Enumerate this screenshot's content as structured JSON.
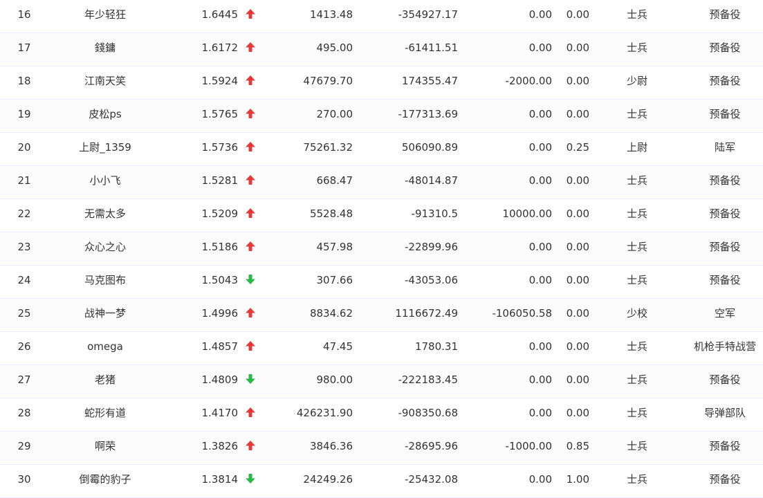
{
  "colors": {
    "up": "#e03b3b",
    "down": "#2fb44a",
    "text": "#333333",
    "row_border": "#ebeef5"
  },
  "rows": [
    {
      "rank": "16",
      "name": "年少轻狂",
      "ratio": "1.6445",
      "trend": "up",
      "a": "1413.48",
      "b": "-354927.17",
      "c": "0.00",
      "d": "0.00",
      "rank_title": "士兵",
      "unit": "预备役"
    },
    {
      "rank": "17",
      "name": "錢鏞",
      "ratio": "1.6172",
      "trend": "up",
      "a": "495.00",
      "b": "-61411.51",
      "c": "0.00",
      "d": "0.00",
      "rank_title": "士兵",
      "unit": "预备役"
    },
    {
      "rank": "18",
      "name": "江南天笑",
      "ratio": "1.5924",
      "trend": "up",
      "a": "47679.70",
      "b": "174355.47",
      "c": "-2000.00",
      "d": "0.00",
      "rank_title": "少尉",
      "unit": "预备役"
    },
    {
      "rank": "19",
      "name": "皮松ps",
      "ratio": "1.5765",
      "trend": "up",
      "a": "270.00",
      "b": "-177313.69",
      "c": "0.00",
      "d": "0.00",
      "rank_title": "士兵",
      "unit": "预备役"
    },
    {
      "rank": "20",
      "name": "上尉_1359",
      "ratio": "1.5736",
      "trend": "up",
      "a": "75261.32",
      "b": "506090.89",
      "c": "0.00",
      "d": "0.25",
      "rank_title": "上尉",
      "unit": "陆军"
    },
    {
      "rank": "21",
      "name": "小小飞",
      "ratio": "1.5281",
      "trend": "up",
      "a": "668.47",
      "b": "-48014.87",
      "c": "0.00",
      "d": "0.00",
      "rank_title": "士兵",
      "unit": "预备役"
    },
    {
      "rank": "22",
      "name": "无需太多",
      "ratio": "1.5209",
      "trend": "up",
      "a": "5528.48",
      "b": "-91310.5",
      "c": "10000.00",
      "d": "0.00",
      "rank_title": "士兵",
      "unit": "预备役"
    },
    {
      "rank": "23",
      "name": "众心之心",
      "ratio": "1.5186",
      "trend": "up",
      "a": "457.98",
      "b": "-22899.96",
      "c": "0.00",
      "d": "0.00",
      "rank_title": "士兵",
      "unit": "预备役"
    },
    {
      "rank": "24",
      "name": "马克图布",
      "ratio": "1.5043",
      "trend": "down",
      "a": "307.66",
      "b": "-43053.06",
      "c": "0.00",
      "d": "0.00",
      "rank_title": "士兵",
      "unit": "预备役"
    },
    {
      "rank": "25",
      "name": "战神一梦",
      "ratio": "1.4996",
      "trend": "up",
      "a": "8834.62",
      "b": "1116672.49",
      "c": "-106050.58",
      "d": "0.00",
      "rank_title": "少校",
      "unit": "空军"
    },
    {
      "rank": "26",
      "name": "omega",
      "ratio": "1.4857",
      "trend": "up",
      "a": "47.45",
      "b": "1780.31",
      "c": "0.00",
      "d": "0.00",
      "rank_title": "士兵",
      "unit": "机枪手特战营"
    },
    {
      "rank": "27",
      "name": "老猪",
      "ratio": "1.4809",
      "trend": "down",
      "a": "980.00",
      "b": "-222183.45",
      "c": "0.00",
      "d": "0.00",
      "rank_title": "士兵",
      "unit": "预备役"
    },
    {
      "rank": "28",
      "name": "蛇形有道",
      "ratio": "1.4170",
      "trend": "up",
      "a": "426231.90",
      "b": "-908350.68",
      "c": "0.00",
      "d": "0.00",
      "rank_title": "士兵",
      "unit": "导弹部队"
    },
    {
      "rank": "29",
      "name": "啊荣",
      "ratio": "1.3826",
      "trend": "up",
      "a": "3846.36",
      "b": "-28695.96",
      "c": "-1000.00",
      "d": "0.85",
      "rank_title": "士兵",
      "unit": "预备役"
    },
    {
      "rank": "30",
      "name": "倒霉的豹子",
      "ratio": "1.3814",
      "trend": "down",
      "a": "24249.26",
      "b": "-25432.08",
      "c": "0.00",
      "d": "1.00",
      "rank_title": "士兵",
      "unit": "预备役"
    }
  ]
}
